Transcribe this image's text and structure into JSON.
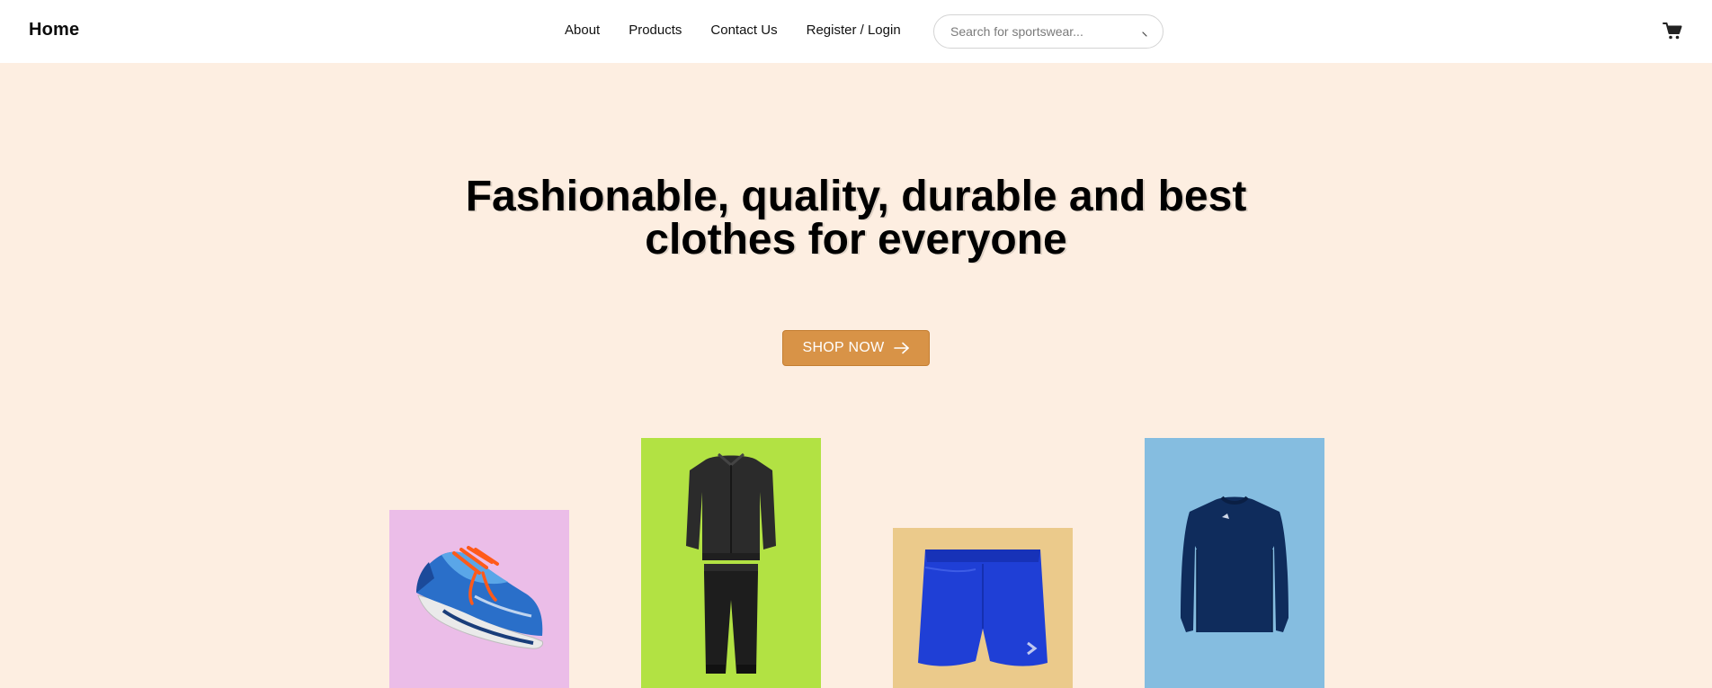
{
  "header": {
    "brand": "Home",
    "nav": [
      "About",
      "Products",
      "Contact Us",
      "Register / Login"
    ],
    "search_placeholder": "Search for sportswear...",
    "search_icon": "search-icon",
    "cart_icon": "cart-icon"
  },
  "hero": {
    "title_line1": "Fashionable, quality, durable and best",
    "title_line2": "clothes for everyone",
    "cta_label": "SHOP NOW",
    "cta_icon": "arrow-right-icon"
  },
  "products": [
    {
      "name": "sneaker",
      "bg": "#EBBDE8"
    },
    {
      "name": "tracksuit",
      "bg": "#B2E243"
    },
    {
      "name": "shorts",
      "bg": "#EBCA8B"
    },
    {
      "name": "long-sleeve-shirt",
      "bg": "#85BDE0"
    }
  ],
  "colors": {
    "page_bg": "#FDEEE1",
    "header_bg": "#FFFFFF",
    "accent": "#D89347"
  }
}
